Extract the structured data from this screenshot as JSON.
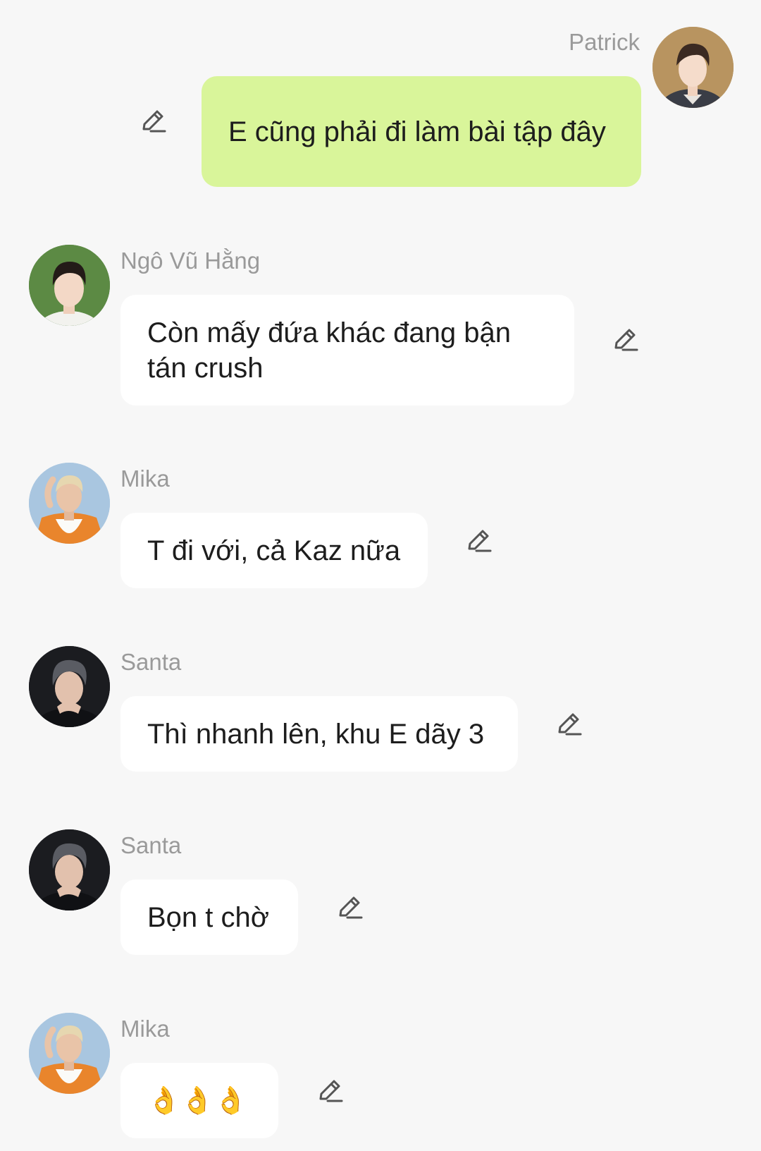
{
  "messages": [
    {
      "sender": "Patrick",
      "text": "E cũng phải đi làm bài tập đây",
      "direction": "outgoing",
      "avatar_icon": "avatar-patrick"
    },
    {
      "sender": "Ngô Vũ Hằng",
      "text": "Còn mấy đứa khác đang bận tán crush",
      "direction": "incoming",
      "avatar_icon": "avatar-ngo-vu-hang"
    },
    {
      "sender": "Mika",
      "text": "T đi với, cả Kaz nữa",
      "direction": "incoming",
      "avatar_icon": "avatar-mika"
    },
    {
      "sender": "Santa",
      "text": "Thì nhanh lên, khu E dãy 3",
      "direction": "incoming",
      "avatar_icon": "avatar-santa"
    },
    {
      "sender": "Santa",
      "text": "Bọn t chờ",
      "direction": "incoming",
      "avatar_icon": "avatar-santa"
    },
    {
      "sender": "Mika",
      "text": "👌👌👌",
      "direction": "incoming",
      "avatar_icon": "avatar-mika"
    }
  ],
  "colors": {
    "background": "#f7f7f7",
    "outgoing_bubble": "#d9f59a",
    "incoming_bubble": "#ffffff",
    "sender_name": "#9a9a9a",
    "text": "#1d1d1d",
    "edit_icon": "#555555"
  },
  "icons": {
    "edit": "pencil-edit-icon"
  }
}
